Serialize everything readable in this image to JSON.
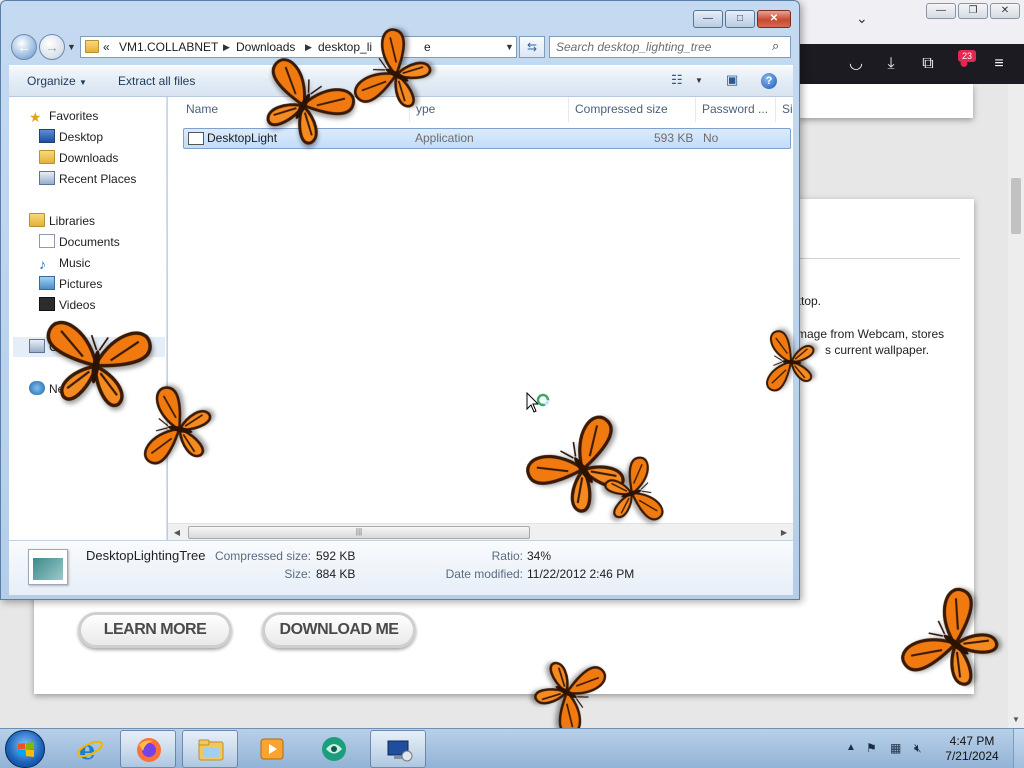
{
  "browser": {
    "toolbar_badge": "23",
    "page": {
      "text_line1": "ktop.",
      "text_line2": "mage from Webcam, stores",
      "text_line3": "s current wallpaper.",
      "learn_more": "LEARN MORE",
      "download_me": "DOWNLOAD ME"
    },
    "icons": [
      "chevron-down-icon",
      "pocket-icon",
      "download-icon",
      "extensions-icon",
      "notification-icon",
      "menu-icon"
    ]
  },
  "explorer": {
    "caption": {
      "minimize": "—",
      "maximize": "□",
      "close": "✕"
    },
    "breadcrumb": {
      "overflow": "«",
      "items": [
        "VM1.COLLABNET",
        "Downloads",
        "desktop_li"
      ],
      "tail": "e"
    },
    "search_placeholder": "Search desktop_lighting_tree",
    "commands": {
      "organize": "Organize",
      "extract": "Extract all files"
    },
    "nav": [
      {
        "label": "Favorites",
        "icon": "star-icon"
      },
      {
        "label": "Desktop",
        "icon": "desktop-icon"
      },
      {
        "label": "Downloads",
        "icon": "downloads-folder-icon"
      },
      {
        "label": "Recent Places",
        "icon": "recent-places-icon"
      },
      {
        "label": "Libraries",
        "icon": "libraries-icon"
      },
      {
        "label": "Documents",
        "icon": "documents-icon"
      },
      {
        "label": "Music",
        "icon": "music-icon"
      },
      {
        "label": "Pictures",
        "icon": "pictures-icon"
      },
      {
        "label": "Videos",
        "icon": "videos-icon"
      },
      {
        "label": "Co",
        "icon": "computer-icon"
      },
      {
        "label": "Netw",
        "icon": "network-icon"
      }
    ],
    "columns": [
      "Name",
      "ype",
      "Compressed size",
      "Password ...",
      "Si"
    ],
    "rows": [
      {
        "name": "DesktopLight",
        "type": "Application",
        "compressed": "593 KB",
        "password": "No"
      }
    ],
    "details": {
      "filename": "DesktopLightingTree",
      "compressed_label": "Compressed size:",
      "compressed_value": "592 KB",
      "size_label": "Size:",
      "size_value": "884 KB",
      "ratio_label": "Ratio:",
      "ratio_value": "34%",
      "modified_label": "Date modified:",
      "modified_value": "11/22/2012 2:46 PM"
    }
  },
  "taskbar": {
    "apps": [
      "internet-explorer-icon",
      "firefox-icon",
      "windows-explorer-icon",
      "media-player-icon",
      "app-globe-icon",
      "remote-desktop-icon"
    ],
    "tray_icons": [
      "show-hidden-icon",
      "action-center-flag-icon",
      "network-icon",
      "volume-muted-icon"
    ],
    "time": "4:47 PM",
    "date": "7/21/2024"
  },
  "colors": {
    "butterfly_orange": "#f07a10",
    "butterfly_dark": "#3a1a05",
    "browser_toolbar": "#1c1b22",
    "explorer_frame": "#bcd4ee",
    "selection": "#c1dcfb"
  }
}
